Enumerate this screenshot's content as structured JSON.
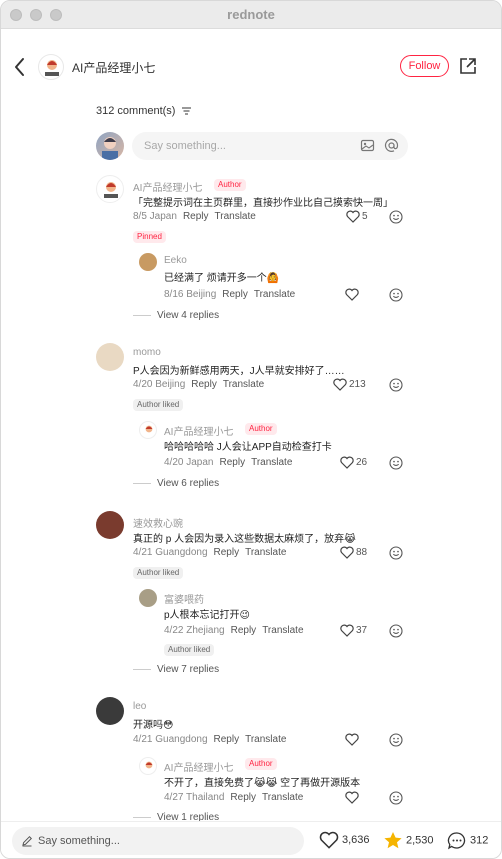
{
  "window": {
    "title": "rednote"
  },
  "header": {
    "author": "AI产品经理小七",
    "follow_label": "Follow"
  },
  "comments_header": {
    "count_label": "312 comment(s)"
  },
  "input": {
    "placeholder": "Say something..."
  },
  "comments": [
    {
      "name": "AI产品经理小七",
      "badge": "Author",
      "text": "「完整提示词在主页群里，直接抄作业比自己摸索快一周」",
      "date_loc": "8/5 Japan",
      "reply": "Reply",
      "translate": "Translate",
      "likes": "5",
      "pinned": "Pinned"
    },
    {
      "name": "Eeko",
      "text": "已经满了 烦请开多一个🙆",
      "date_loc": "8/16 Beijing",
      "reply": "Reply",
      "translate": "Translate",
      "likes": "",
      "more": "View 4 replies"
    },
    {
      "name": "momo",
      "text": "P人会因为新鲜感用两天，J人早就安排好了……",
      "date_loc": "4/20 Beijing",
      "reply": "Reply",
      "translate": "Translate",
      "likes": "213",
      "liked": "Author liked"
    },
    {
      "name": "AI产品经理小七",
      "badge": "Author",
      "text": "哈哈哈哈哈 J人会让APP自动检查打卡",
      "date_loc": "4/20 Japan",
      "reply": "Reply",
      "translate": "Translate",
      "likes": "26",
      "more": "View 6 replies"
    },
    {
      "name": "速效救心豌",
      "text": "真正的 p 人会因为录入这些数据太麻烦了，放弃😹",
      "date_loc": "4/21 Guangdong",
      "reply": "Reply",
      "translate": "Translate",
      "likes": "88",
      "liked": "Author liked"
    },
    {
      "name": "富婆喂药",
      "text": "p人根本忘记打开😉",
      "date_loc": "4/22 Zhejiang",
      "reply": "Reply",
      "translate": "Translate",
      "likes": "37",
      "liked": "Author liked",
      "more": "View 7 replies"
    },
    {
      "name": "leo",
      "text": "开源吗😳",
      "date_loc": "4/21 Guangdong",
      "reply": "Reply",
      "translate": "Translate",
      "likes": ""
    },
    {
      "name": "AI产品经理小七",
      "badge": "Author",
      "text": "不开了，直接免费了😹😹 空了再做开源版本",
      "date_loc": "4/27 Thailand",
      "reply": "Reply",
      "translate": "Translate",
      "likes": "",
      "more": "View 1 replies"
    }
  ],
  "bottom": {
    "placeholder": "Say something...",
    "likes": "3,636",
    "collects": "2,530",
    "comments": "312"
  },
  "colors": {
    "accent": "#ff2442",
    "star": "#f5b400"
  }
}
